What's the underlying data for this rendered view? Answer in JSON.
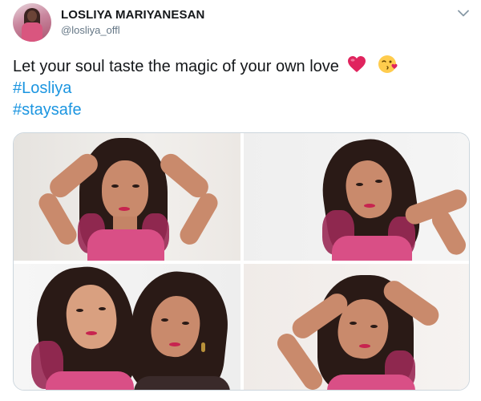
{
  "author": {
    "display_name": "LOSLIYA MARIYANESAN",
    "handle": "@losliya_offl",
    "avatar_icon": "profile-photo"
  },
  "tweet": {
    "text_main": "Let your soul taste the magic of your own  love",
    "hashtags": [
      "#Losliya",
      "#staysafe"
    ],
    "emojis": [
      "heart-emoji",
      "face-blowing-kiss-emoji"
    ]
  },
  "menu": {
    "icon": "chevron-down-icon"
  },
  "media": {
    "photo_count": 4
  },
  "colors": {
    "text": "#14171a",
    "secondary": "#657786",
    "link": "#1b95e0",
    "border": "#ccd6dd"
  }
}
